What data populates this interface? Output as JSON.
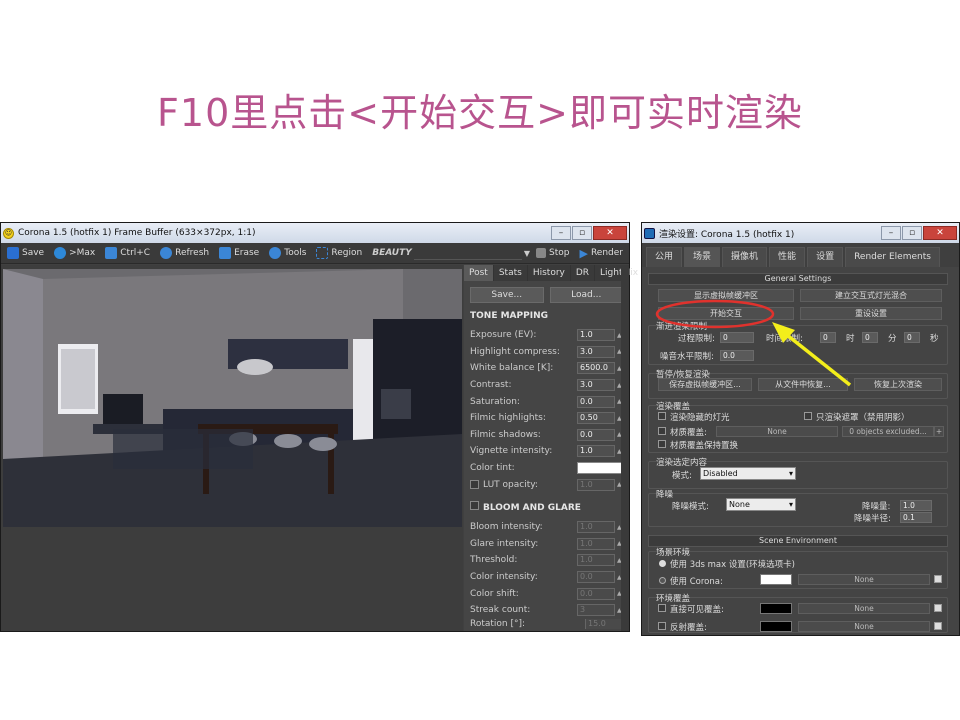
{
  "slide": {
    "title": "F10里点击<开始交互>即可实时渲染"
  },
  "framebuffer": {
    "title": "Corona 1.5 (hotfix 1) Frame Buffer (633×372px, 1:1)",
    "toolbar": {
      "save": "Save",
      "max": ">Max",
      "ctrlc": "Ctrl+C",
      "refresh": "Refresh",
      "erase": "Erase",
      "tools": "Tools",
      "region": "Region",
      "pass": "BEAUTY",
      "stop": "Stop",
      "render": "Render"
    },
    "tabs": [
      "Post",
      "Stats",
      "History",
      "DR",
      "LightMix"
    ],
    "panel": {
      "save_btn": "Save...",
      "load_btn": "Load...",
      "tone_mapping": "TONE MAPPING",
      "exposure": {
        "label": "Exposure (EV):",
        "value": "1.0"
      },
      "highlight": {
        "label": "Highlight compress:",
        "value": "3.0"
      },
      "white_balance": {
        "label": "White balance [K]:",
        "value": "6500.0"
      },
      "contrast": {
        "label": "Contrast:",
        "value": "3.0"
      },
      "saturation": {
        "label": "Saturation:",
        "value": "0.0"
      },
      "filmic_highlights": {
        "label": "Filmic highlights:",
        "value": "0.50"
      },
      "filmic_shadows": {
        "label": "Filmic shadows:",
        "value": "0.0"
      },
      "vignette": {
        "label": "Vignette intensity:",
        "value": "1.0"
      },
      "color_tint": {
        "label": "Color tint:"
      },
      "lut_opacity": {
        "label": "LUT opacity:",
        "value": "1.0"
      },
      "bloom_glare": "BLOOM AND GLARE",
      "bloom_intensity": {
        "label": "Bloom intensity:",
        "value": "1.0"
      },
      "glare_intensity": {
        "label": "Glare intensity:",
        "value": "1.0"
      },
      "threshold": {
        "label": "Threshold:",
        "value": "1.0"
      },
      "color_intensity": {
        "label": "Color intensity:",
        "value": "0.0"
      },
      "color_shift": {
        "label": "Color shift:",
        "value": "0.0"
      },
      "streak_count": {
        "label": "Streak count:",
        "value": "3"
      },
      "rotation": {
        "label": "Rotation [°]:",
        "value": "15.0"
      }
    }
  },
  "render_setup": {
    "title": "渲染设置: Corona 1.5 (hotfix 1)",
    "tabs": [
      "公用",
      "场景",
      "摄像机",
      "性能",
      "设置",
      "Render Elements"
    ],
    "general": {
      "header": "General Settings",
      "show_vfb": "显示虚拟帧缓冲区",
      "build_lightmix": "建立交互式灯光混合",
      "start_interactive": "开始交互",
      "reset_settings": "重设设置",
      "progressive_limit": "渐进渲染限制",
      "pass_limit": "过程限制:",
      "pass_value": "0",
      "time_limit": "时间限制:",
      "t_h": "0",
      "h": "时",
      "t_m": "0",
      "m": "分",
      "t_s": "0",
      "s": "秒",
      "noise_limit": "噪音水平限制:",
      "noise_value": "0.0",
      "pause_resume": "暂停/恢复渲染",
      "save_vfb": "保存虚拟帧缓冲区...",
      "resume_file": "从文件中恢复...",
      "resume_last": "恢复上次渲染",
      "render_override": "渲染覆盖",
      "render_hidden": "渲染隐藏的灯光",
      "shadow_only": "只渲染遮罩（禁用阴影）",
      "mtl_override": "材质覆盖:",
      "none": "None",
      "objects_excluded": "0 objects excluded...",
      "plus": "+",
      "preserve_disp": "材质覆盖保持置换",
      "render_selected": "渲染选定内容",
      "mode_label": "模式:",
      "mode_value": "Disabled",
      "denoise": "降噪",
      "denoise_mode_label": "降噪模式:",
      "denoise_mode_value": "None",
      "denoise_amount_label": "降噪量:",
      "denoise_amount": "1.0",
      "denoise_radius_label": "降噪半径:",
      "denoise_radius": "0.1"
    },
    "scene_env": {
      "header": "Scene Environment",
      "env_group": "场景环境",
      "use_3dsmax": "使用 3ds max 设置(环境选项卡)",
      "use_corona": "使用 Corona:",
      "env_override": "环境覆盖",
      "direct_visible": "直接可见覆盖:",
      "reflect": "反射覆盖:",
      "none": "None"
    }
  },
  "colors": {
    "title_pink": "#b8548e",
    "annot_red": "#e0322d",
    "annot_yellow": "#f3ee1b"
  }
}
